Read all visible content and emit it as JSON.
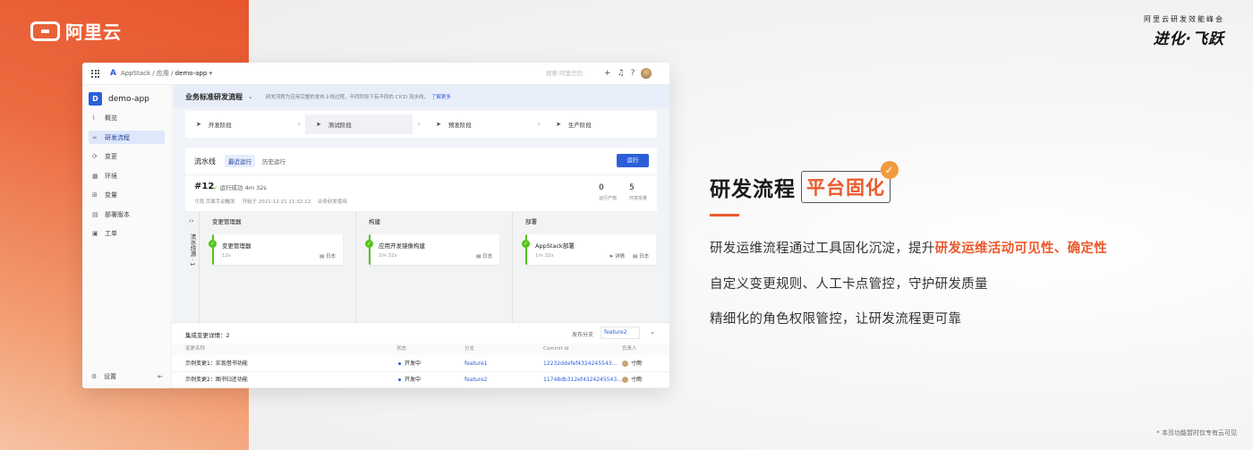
{
  "brand": {
    "logo_text": "阿里云",
    "summit_top": "阿里云研发效能峰会",
    "summit_main": "进化·飞跃"
  },
  "topbar": {
    "product": "AppStack",
    "crumb_mid": "/ 应用 /",
    "app": "demo-app",
    "search_placeholder": "搜索 阿里巴巴"
  },
  "sidebar": {
    "app_badge": "D",
    "app_name": "demo-app",
    "items": [
      {
        "icon": "chart-icon",
        "label": "概览"
      },
      {
        "icon": "flow-icon",
        "label": "研发流程"
      },
      {
        "icon": "change-icon",
        "label": "变更"
      },
      {
        "icon": "env-icon",
        "label": "环境"
      },
      {
        "icon": "variable-icon",
        "label": "变量"
      },
      {
        "icon": "version-icon",
        "label": "部署版本"
      },
      {
        "icon": "ticket-icon",
        "label": "工单"
      }
    ],
    "settings": "设置"
  },
  "flow": {
    "title": "业务标准研发流程",
    "desc": "研发流程为应用完整的发布上线过程，不同阶段下有不同的 CICD 流水线，",
    "more": "了解更多",
    "stages": [
      "开发阶段",
      "测试阶段",
      "预发阶段",
      "生产阶段"
    ]
  },
  "pipeline": {
    "title": "流水线",
    "tab_recent": "最近运行",
    "tab_history": "历史运行",
    "run_button": "运行",
    "run_no": "#12",
    "status": "运行成功 4m 32s",
    "meta_user": "寸雨 页面手动触发",
    "meta_start": "开始于 2021-12-21 11:32:12",
    "meta_tpl": "业务研发使用",
    "kpis": [
      {
        "value": "0",
        "label": "运行产物"
      },
      {
        "value": "5",
        "label": "环境变量"
      }
    ],
    "vertical_label": "流水线源 · 1",
    "columns": [
      {
        "title": "变更管理器",
        "task": "变更管理器",
        "time": "12s",
        "actions": [
          "日志"
        ]
      },
      {
        "title": "构建",
        "task": "应用开发镜像构建",
        "time": "2m 32s",
        "actions": [
          "日志"
        ]
      },
      {
        "title": "部署",
        "task": "AppStack部署",
        "time": "1m 32s",
        "actions": [
          "详情",
          "日志"
        ]
      }
    ]
  },
  "changes": {
    "title": "集成变更详情：2",
    "branch_label": "发布分支",
    "branch": "feature2",
    "headers": [
      "变更名称",
      "状态",
      "分支",
      "Commit Id",
      "负责人"
    ],
    "rows": [
      {
        "name": "示例变更1：实现借书功能",
        "status": "开发中",
        "branch": "feature1",
        "commit": "12232ddefef4324245543...",
        "owner": "寸雨"
      },
      {
        "name": "示例变更2：图书归还功能",
        "status": "开发中",
        "branch": "feature2",
        "commit": "11748db312ef4324245543...",
        "owner": "寸雨"
      }
    ]
  },
  "feature": {
    "title_a": "研发流程",
    "title_b": "平台固化",
    "line1_a": "研发运维流程通过工具固化沉淀，提升",
    "line1_b": "研发运维活动可见性、确定性",
    "line2": "自定义变更规则、人工卡点管控，守护研发质量",
    "line3": "精细化的角色权限管控，让研发流程更可靠"
  },
  "footnote": "* 本页功能暂时仅专有云可见",
  "colors": {
    "accent": "#ea5a2c",
    "primary": "#2b5fd9",
    "success": "#52c41a"
  }
}
